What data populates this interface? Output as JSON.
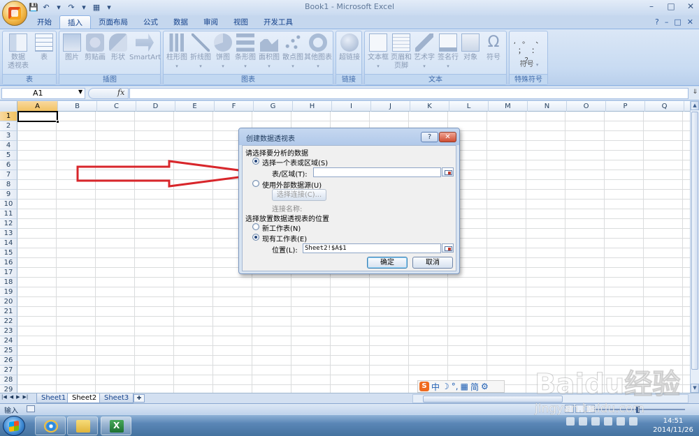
{
  "window": {
    "title": "Book1 - Microsoft Excel",
    "controls": [
      "–",
      "□",
      "✕"
    ]
  },
  "qat": [
    "💾",
    "↶",
    "▾",
    "↷",
    "▾",
    "▦",
    "▾"
  ],
  "ribbon": {
    "tabs": [
      "开始",
      "插入",
      "页面布局",
      "公式",
      "数据",
      "审阅",
      "视图",
      "开发工具"
    ],
    "active_tab": "插入",
    "right_icons": [
      "?",
      "–",
      "□",
      "✕"
    ],
    "groups": {
      "table": {
        "label": "表",
        "buttons": [
          "数据\n透视表",
          "表"
        ]
      },
      "illustrations": {
        "label": "插图",
        "buttons": [
          "图片",
          "剪贴画",
          "形状",
          "SmartArt"
        ]
      },
      "charts": {
        "label": "图表",
        "buttons": [
          "柱形图",
          "折线图",
          "饼图",
          "条形图",
          "面积图",
          "散点图",
          "其他图表"
        ]
      },
      "links": {
        "label": "链接",
        "buttons": [
          "超链接"
        ]
      },
      "text": {
        "label": "文本",
        "buttons": [
          "文本框",
          "页眉和\n页脚",
          "艺术字",
          "签名行",
          "对象",
          "符号"
        ]
      },
      "special_symbols": {
        "label": "特殊符号",
        "chars": ", 。 、 ； ： ？",
        "button": "符号"
      }
    }
  },
  "formula_bar": {
    "name_box": "A1",
    "fx_label": "fx",
    "formula": ""
  },
  "grid": {
    "columns": [
      "A",
      "B",
      "C",
      "D",
      "E",
      "F",
      "G",
      "H",
      "I",
      "J",
      "K",
      "L",
      "M",
      "N",
      "O",
      "P",
      "Q"
    ],
    "rows": [
      "1",
      "2",
      "3",
      "4",
      "5",
      "6",
      "7",
      "8",
      "9",
      "10",
      "11",
      "12",
      "13",
      "14",
      "15",
      "16",
      "17",
      "18",
      "19",
      "20",
      "21",
      "22",
      "23",
      "24",
      "25",
      "26",
      "27",
      "28",
      "29"
    ],
    "active_cell": "A1"
  },
  "sheets": {
    "tabs": [
      "Sheet1",
      "Sheet2",
      "Sheet3"
    ],
    "active": "Sheet2"
  },
  "status": {
    "mode": "输入"
  },
  "dialog": {
    "title": "创建数据透视表",
    "help": "?",
    "close": "✕",
    "section1": "请选择要分析的数据",
    "option_range": "选择一个表或区域(S)",
    "range_label": "表/区域(T):",
    "range_value": "",
    "option_external": "使用外部数据源(U)",
    "choose_connection": "选择连接(C)...",
    "connection_name": "连接名称:",
    "section2": "选择放置数据透视表的位置",
    "option_new_sheet": "新工作表(N)",
    "option_existing": "现有工作表(E)",
    "location_label": "位置(L):",
    "location_value": "Sheet2!$A$1",
    "ok": "确定",
    "cancel": "取消"
  },
  "ime": {
    "logo": "S",
    "items": [
      "中",
      "☽",
      "°,",
      "▦",
      "简",
      "⚙"
    ]
  },
  "taskbar": {
    "time": "14:51",
    "date": "2014/11/26"
  },
  "watermark": {
    "text": "Baidu经验",
    "url": "jingyan.baidu.com"
  }
}
